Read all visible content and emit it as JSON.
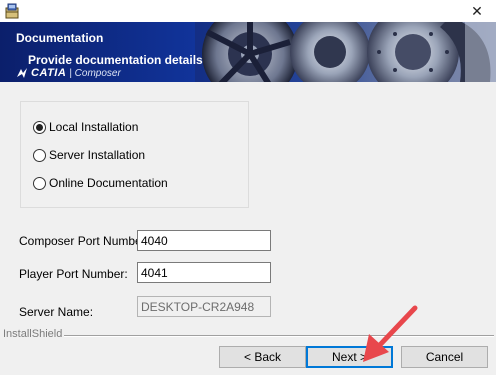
{
  "window": {
    "icon": "installer-icon",
    "close_glyph": "✕"
  },
  "banner": {
    "title": "Documentation",
    "subtitle": "Provide documentation details",
    "logo_text": "CATIA",
    "logo_sub": "| Composer"
  },
  "options": {
    "items": [
      {
        "label": "Local Installation",
        "checked": true
      },
      {
        "label": "Server Installation",
        "checked": false
      },
      {
        "label": "Online Documentation",
        "checked": false
      }
    ]
  },
  "form": {
    "composer_port_label": "Composer Port Number:",
    "composer_port_value": "4040",
    "player_port_label": "Player Port Number:",
    "player_port_value": "4041",
    "server_name_label": "Server Name:",
    "server_name_value": "DESKTOP-CR2A948"
  },
  "footer": {
    "brand": "InstallShield",
    "back_label": "< Back",
    "next_label": "Next >",
    "cancel_label": "Cancel"
  },
  "colors": {
    "banner_dark": "#0b1f6b",
    "banner_mid": "#11349b",
    "focus_border": "#0078d7",
    "annotation_arrow": "#e8474c"
  }
}
